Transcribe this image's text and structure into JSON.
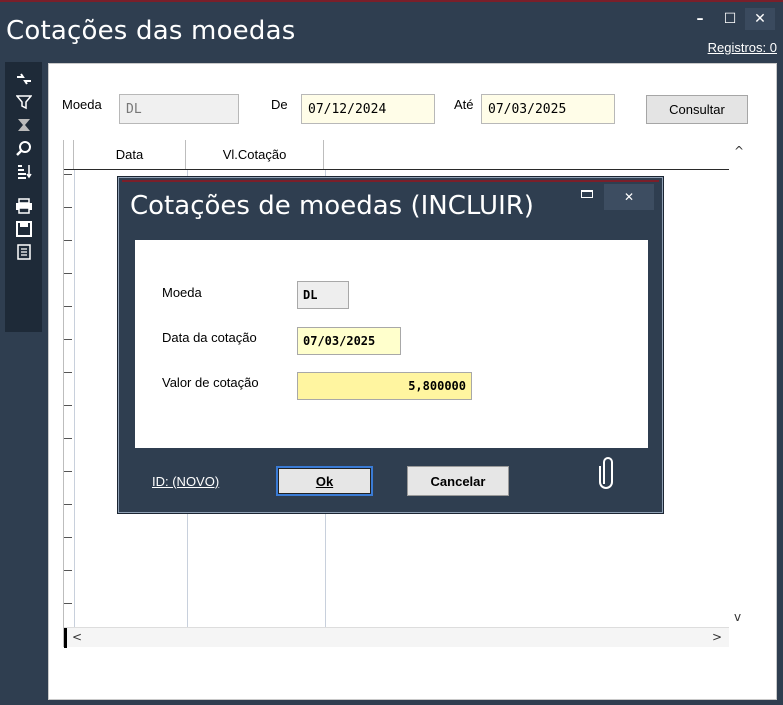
{
  "window": {
    "title": "Cotações das moedas",
    "minimize": "–",
    "maximize": "☐",
    "close": "✕",
    "records_link": "Registros: 0"
  },
  "toolbar": {
    "icons": [
      "refresh-icon",
      "filter-icon",
      "clear-filter-icon",
      "zoom-icon",
      "sort-icon",
      "print-icon",
      "save-icon",
      "report-icon"
    ]
  },
  "filters": {
    "moeda_label": "Moeda",
    "moeda_value": "DL",
    "de_label": "De",
    "de_value": "07/12/2024",
    "ate_label": "Até",
    "ate_value": "07/03/2025",
    "consultar_label": "Consultar"
  },
  "grid": {
    "columns": [
      "Data",
      "Vl.Cotação"
    ],
    "scroll_up": "^",
    "scroll_down": "v",
    "scroll_left": "<",
    "scroll_right": ">"
  },
  "dialog": {
    "title": "Cotações de moedas (INCLUIR)",
    "close": "✕",
    "moeda_label": "Moeda",
    "moeda_value": "DL",
    "data_label": "Data da cotação",
    "data_value": "07/03/2025",
    "valor_label": "Valor de cotação",
    "valor_value": "5,800000",
    "id_text": "ID: (NOVO)",
    "ok_label": "Ok",
    "cancel_label": "Cancelar"
  },
  "colors": {
    "window_bg": "#2f3e50",
    "accent_line": "#7a1f2a",
    "toolbar_bg": "#1e2a38",
    "field_yellow": "#ffffcc"
  }
}
